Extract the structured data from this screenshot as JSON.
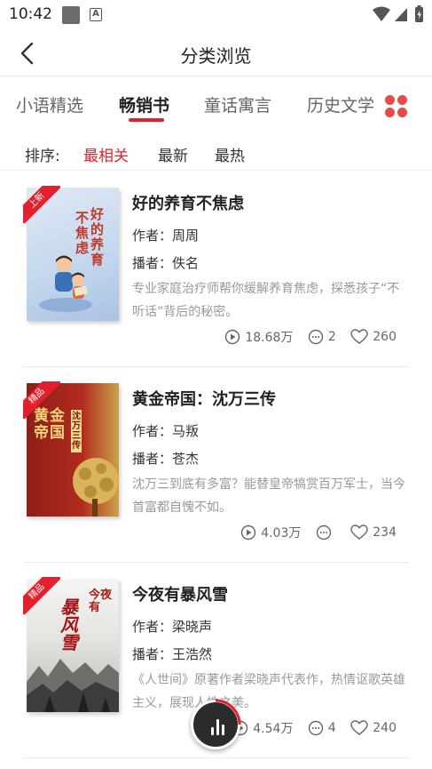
{
  "status_bar": {
    "time": "10:42"
  },
  "header": {
    "title": "分类浏览"
  },
  "tabs": [
    {
      "label": "小语精选",
      "active": false
    },
    {
      "label": "畅销书",
      "active": true
    },
    {
      "label": "童话寓言",
      "active": false
    },
    {
      "label": "历史文学",
      "active": false
    }
  ],
  "sort": {
    "label": "排序:",
    "options": [
      {
        "label": "最相关",
        "active": true
      },
      {
        "label": "最新",
        "active": false
      },
      {
        "label": "最热",
        "active": false
      }
    ]
  },
  "books": [
    {
      "badge": "上新",
      "title": "好的养育不焦虑",
      "author": "作者：周周",
      "narrator": "播者：佚名",
      "desc": "专业家庭治疗师帮你缓解养育焦虑，探悉孩子“不听话”背后的秘密。",
      "plays": "18.68万",
      "comments": "2",
      "likes": "260",
      "cover_text_a": "好的养育",
      "cover_text_b": "不焦虑"
    },
    {
      "badge": "精品",
      "title": "黄金帝国：沈万三传",
      "author": "作者：马叛",
      "narrator": "播者：苍杰",
      "desc": "沈万三到底有多富？能替皇帝犒赏百万军士，当今首富都自愧不如。",
      "plays": "4.03万",
      "comments": "",
      "likes": "234",
      "cover_text_a": "黄金帝国",
      "cover_text_b": "沈万三传"
    },
    {
      "badge": "精品",
      "title": "今夜有暴风雪",
      "author": "作者：梁晓声",
      "narrator": "播者：王浩然",
      "desc": "《人世间》原著作者梁晓声代表作，热情讴歌英雄主义，展现人性之美。",
      "plays": "4.54万",
      "comments": "4",
      "likes": "240",
      "cover_text_a": "今夜有",
      "cover_text_b": "暴风雪"
    }
  ],
  "colors": {
    "accent": "#e5202e",
    "text": "#222222",
    "muted": "#999999"
  }
}
